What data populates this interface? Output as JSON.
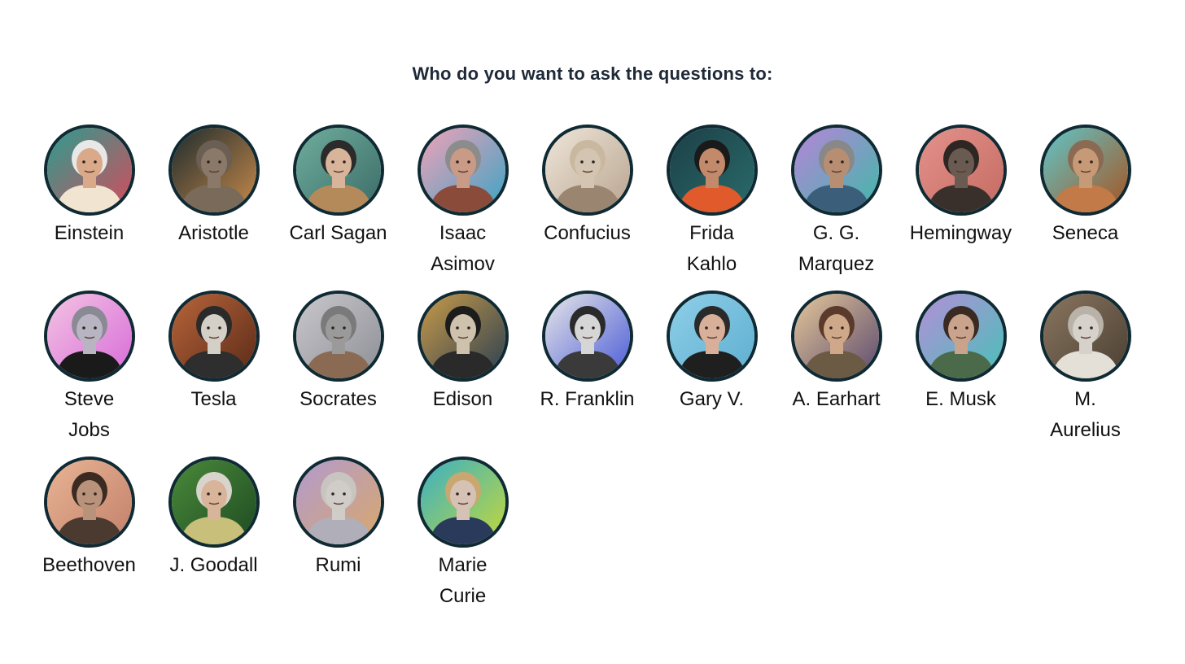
{
  "prompt": "Who do you want to ask the questions to:",
  "people": [
    {
      "name": "Einstein",
      "bg1": "#2a9d8f",
      "bg2": "#d64b5c",
      "skin": "#d9a98a",
      "hair": "#e8e8e8",
      "cloth": "#f1e4d0",
      "avatar": "einstein-portrait-icon"
    },
    {
      "name": "Aristotle",
      "bg1": "#1d2b2e",
      "bg2": "#c88a4a",
      "skin": "#8a7968",
      "hair": "#6b5e52",
      "cloth": "#7a6a5a",
      "avatar": "aristotle-portrait-icon"
    },
    {
      "name": "Carl Sagan",
      "bg1": "#6fae9e",
      "bg2": "#3b6b66",
      "skin": "#d8b49a",
      "hair": "#2b2b2b",
      "cloth": "#b48a5a",
      "avatar": "carl-sagan-portrait-icon"
    },
    {
      "name": "Isaac Asimov",
      "bg1": "#f2a2b8",
      "bg2": "#3aa3c4",
      "skin": "#c99a86",
      "hair": "#8c8c8c",
      "cloth": "#8a4b3a",
      "avatar": "isaac-asimov-portrait-icon"
    },
    {
      "name": "Confucius",
      "bg1": "#efe6da",
      "bg2": "#b8a48e",
      "skin": "#d3c5b1",
      "hair": "#c8b89f",
      "cloth": "#9a8670",
      "avatar": "confucius-portrait-icon"
    },
    {
      "name": "Frida Kahlo",
      "bg1": "#1c3f47",
      "bg2": "#2a6c6b",
      "skin": "#c28a6a",
      "hair": "#1a1a1a",
      "cloth": "#e05a2b",
      "avatar": "frida-kahlo-portrait-icon"
    },
    {
      "name": "G. G. Marquez",
      "bg1": "#b784d9",
      "bg2": "#3fb9a8",
      "skin": "#b88e72",
      "hair": "#888888",
      "cloth": "#3b5f7a",
      "avatar": "marquez-portrait-icon"
    },
    {
      "name": "Hemingway",
      "bg1": "#e4928c",
      "bg2": "#c46b62",
      "skin": "#6a5b52",
      "hair": "#2e2622",
      "cloth": "#3a302b",
      "avatar": "hemingway-portrait-icon"
    },
    {
      "name": "Seneca",
      "bg1": "#5fc6c9",
      "bg2": "#a8521f",
      "skin": "#c69a76",
      "hair": "#8a6a52",
      "cloth": "#c27a48",
      "avatar": "seneca-portrait-icon"
    },
    {
      "name": "Steve Jobs",
      "bg1": "#f3c4e3",
      "bg2": "#d86ad8",
      "skin": "#b8b4c2",
      "hair": "#8a8a95",
      "cloth": "#1a1a1a",
      "avatar": "steve-jobs-portrait-icon"
    },
    {
      "name": "Tesla",
      "bg1": "#b8653a",
      "bg2": "#5a2a18",
      "skin": "#d4d0c8",
      "hair": "#2a2a2a",
      "cloth": "#2e2e2e",
      "avatar": "tesla-portrait-icon"
    },
    {
      "name": "Socrates",
      "bg1": "#c8c8cc",
      "bg2": "#8e8e96",
      "skin": "#9a9a9a",
      "hair": "#7a7a7a",
      "cloth": "#8a6a52",
      "avatar": "socrates-portrait-icon"
    },
    {
      "name": "Edison",
      "bg1": "#c89a48",
      "bg2": "#2a3f52",
      "skin": "#cfc2ad",
      "hair": "#1c1c1c",
      "cloth": "#2a2a2a",
      "avatar": "edison-portrait-icon"
    },
    {
      "name": "R. Franklin",
      "bg1": "#e6e6e6",
      "bg2": "#4a5bd8",
      "skin": "#d6d6d6",
      "hair": "#2a2a2a",
      "cloth": "#3a3a3a",
      "avatar": "rosalind-franklin-portrait-icon"
    },
    {
      "name": "Gary V.",
      "bg1": "#8ecfe8",
      "bg2": "#5eaed0",
      "skin": "#d8b09a",
      "hair": "#2a2a2a",
      "cloth": "#1f1f1f",
      "avatar": "gary-v-portrait-icon"
    },
    {
      "name": "A. Earhart",
      "bg1": "#e6c79a",
      "bg2": "#5a4a6e",
      "skin": "#cfa88a",
      "hair": "#5a3a2a",
      "cloth": "#6b5a44",
      "avatar": "earhart-portrait-icon"
    },
    {
      "name": "E. Musk",
      "bg1": "#b48fd8",
      "bg2": "#48c0b8",
      "skin": "#c9a38c",
      "hair": "#3a2a22",
      "cloth": "#4a6a4a",
      "avatar": "elon-musk-portrait-icon"
    },
    {
      "name": "M. Aurelius",
      "bg1": "#8a7660",
      "bg2": "#4a3e32",
      "skin": "#d6d2cb",
      "hair": "#b8b2a8",
      "cloth": "#e4e0d8",
      "avatar": "marcus-aurelius-portrait-icon"
    },
    {
      "name": "Beethoven",
      "bg1": "#e8b494",
      "bg2": "#c2806a",
      "skin": "#b8927a",
      "hair": "#3a2a22",
      "cloth": "#4a3a30",
      "avatar": "beethoven-portrait-icon"
    },
    {
      "name": "J. Goodall",
      "bg1": "#4a8a3a",
      "bg2": "#1e4a22",
      "skin": "#d8b49a",
      "hair": "#d8d4cc",
      "cloth": "#c8c07a",
      "avatar": "jane-goodall-portrait-icon"
    },
    {
      "name": "Rumi",
      "bg1": "#b29ad0",
      "bg2": "#d8a86a",
      "skin": "#d0ccc8",
      "hair": "#c8c4c0",
      "cloth": "#b0aeb8",
      "avatar": "rumi-portrait-icon"
    },
    {
      "name": "Marie Curie",
      "bg1": "#3ab0c4",
      "bg2": "#c4d83a",
      "skin": "#d6c2b4",
      "hair": "#c8a870",
      "cloth": "#2a3a5a",
      "avatar": "marie-curie-portrait-icon"
    }
  ]
}
